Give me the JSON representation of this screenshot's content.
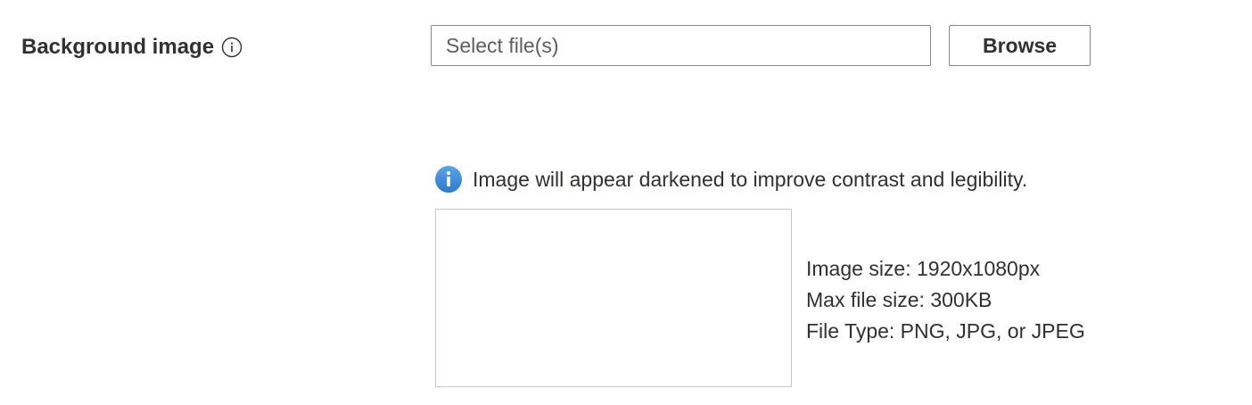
{
  "field": {
    "label": "Background image",
    "info_icon": "info-outline-icon"
  },
  "file_input": {
    "placeholder": "Select file(s)",
    "value": ""
  },
  "browse_button": {
    "label": "Browse"
  },
  "notice": {
    "icon": "info-filled-icon",
    "icon_color": "#3b86d6",
    "text": "Image will appear darkened to improve contrast and legibility."
  },
  "requirements": {
    "image_size": "Image size: 1920x1080px",
    "max_file_size": "Max file size: 300KB",
    "file_type": "File Type: PNG, JPG, or JPEG"
  }
}
